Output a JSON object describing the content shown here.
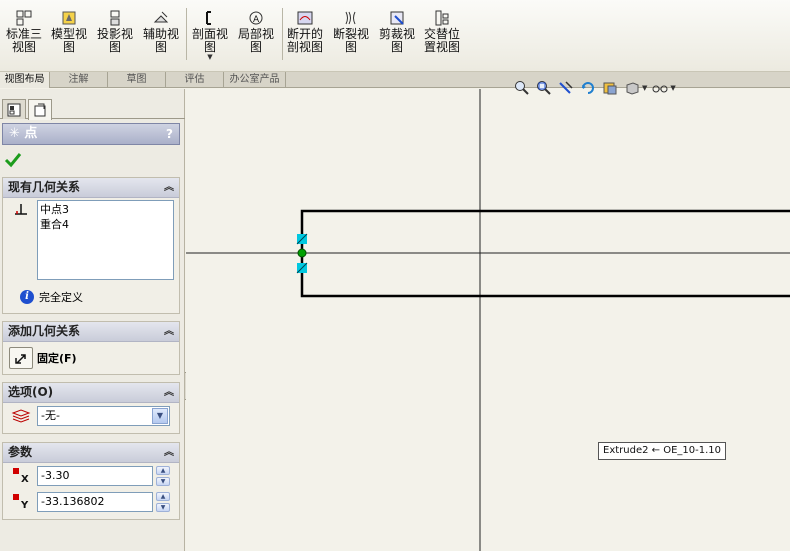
{
  "toolbar": {
    "items": [
      {
        "label1": "标准三",
        "label2": "视图",
        "icon": "standard-3-view-icon"
      },
      {
        "label1": "模型视",
        "label2": "图",
        "icon": "model-view-icon"
      },
      {
        "label1": "投影视",
        "label2": "图",
        "icon": "projected-view-icon"
      },
      {
        "label1": "辅助视",
        "label2": "图",
        "icon": "auxiliary-view-icon"
      },
      {
        "label1": "剖面视",
        "label2": "图",
        "icon": "section-view-icon"
      },
      {
        "label1": "局部视",
        "label2": "图",
        "icon": "detail-view-icon"
      },
      {
        "label1": "断开的",
        "label2": "剖视图",
        "icon": "broken-out-section-icon"
      },
      {
        "label1": "断裂视",
        "label2": "图",
        "icon": "break-view-icon"
      },
      {
        "label1": "剪裁视",
        "label2": "图",
        "icon": "crop-view-icon"
      },
      {
        "label1": "交替位",
        "label2": "置视图",
        "icon": "alternate-position-view-icon"
      }
    ]
  },
  "tabs": [
    "视图布局",
    "注解",
    "草图",
    "评估",
    "办公室产品"
  ],
  "property_manager": {
    "title": "点",
    "help": "?",
    "existing_relations": {
      "header": "现有几何关系",
      "items": [
        "中点3",
        "重合4"
      ],
      "status": "完全定义"
    },
    "add_relations": {
      "header": "添加几何关系",
      "fix_label": "固定(F)"
    },
    "options": {
      "header": "选项(O)",
      "layer_value": "-无-"
    },
    "parameters": {
      "header": "参数",
      "x_label": "X",
      "x_value": "-3.30",
      "y_label": "Y",
      "y_value": "-33.136802"
    }
  },
  "canvas": {
    "tooltip": "Extrude2 ← OE_10-1.10"
  },
  "colors": {
    "handle": "#00c8e0",
    "point": "#00a000",
    "pm_header": "#aab0c9"
  }
}
